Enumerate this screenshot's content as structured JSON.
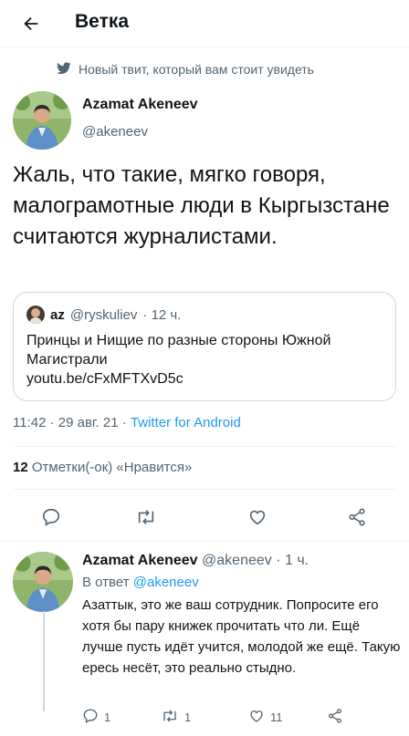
{
  "header": {
    "title": "Ветка"
  },
  "promo": {
    "text": "Новый твит, который вам стоит увидеть"
  },
  "tweet": {
    "author_name": "Azamat Akeneev",
    "author_handle": "@akeneev",
    "text": "Жаль, что такие, мягко говоря, малограмотные люди в Кыргызстане считаются журналистами.",
    "quote": {
      "author_name": "az",
      "author_handle": "@ryskuliev",
      "time": "· 12 ч.",
      "text": "Принцы и Нищие по разные стороны Южной Магистрали",
      "link": "youtu.be/cFxMFTXvD5c"
    },
    "timestamp": "11:42 · 29 авг. 21 · ",
    "source": "Twitter for Android",
    "likes_count": "12",
    "likes_label": " Отметки(-ок) «Нравится»"
  },
  "reply": {
    "author_name": "Azamat Akeneev",
    "handle_time": " @akeneev · 1 ч.",
    "reply_to_prefix": "В ответ ",
    "reply_to_handle": "@akeneev",
    "text": "Азаттык, это же ваш сотрудник. Попросите его хотя бы пару книжек прочитать что ли. Ещё лучше пусть идёт учится, молодой же ещё. Такую ересь несёт, это реально стыдно.",
    "reply_count": "1",
    "retweet_count": "1",
    "like_count": "11"
  },
  "colors": {
    "accent": "#1d9bf0",
    "secondary_text": "#536471",
    "border": "#cfd9de"
  }
}
